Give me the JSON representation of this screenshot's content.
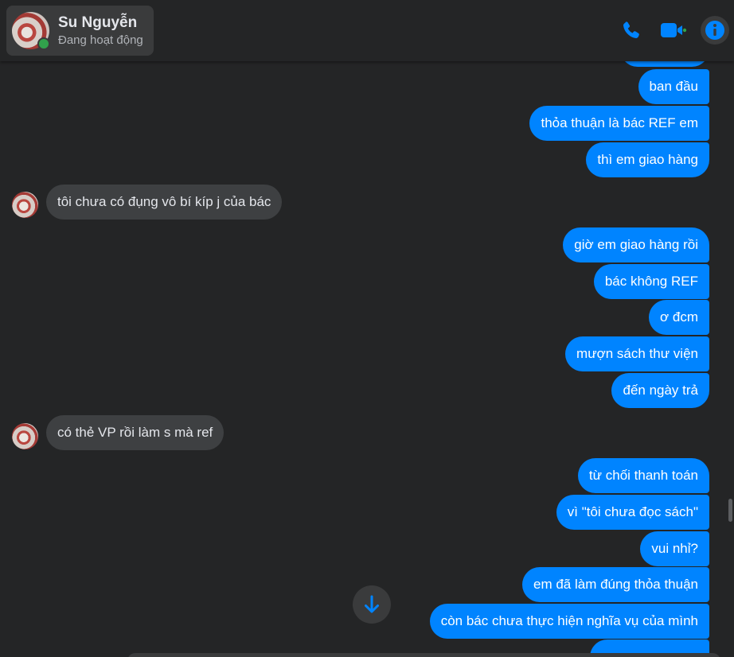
{
  "header": {
    "contact_name": "Su Nguyễn",
    "status": "Đang hoạt động",
    "accent_color": "#0084ff",
    "online_color": "#31a24c",
    "icons": [
      "phone-icon",
      "video-camera-icon",
      "info-icon"
    ]
  },
  "messages": {
    "m1": "ban đầu",
    "m2": "thỏa thuận là bác REF em",
    "m3": "thì em giao hàng",
    "m4": "tôi chưa có đụng vô bí kíp j của bác",
    "m5": "giờ em giao hàng rồi",
    "m6": "bác không REF",
    "m7": "ơ đcm",
    "m8": "mượn sách thư viện",
    "m9": "đến ngày trả",
    "m10": "có thẻ VP rồi làm s mà ref",
    "m11": "từ chối thanh toán",
    "m12": "vì \"tôi chưa đọc sách\"",
    "m13": "vui nhỉ?",
    "m14": "em đã làm đúng thỏa thuận",
    "m15": "còn bác chưa thực hiện nghĩa vụ của mình"
  }
}
